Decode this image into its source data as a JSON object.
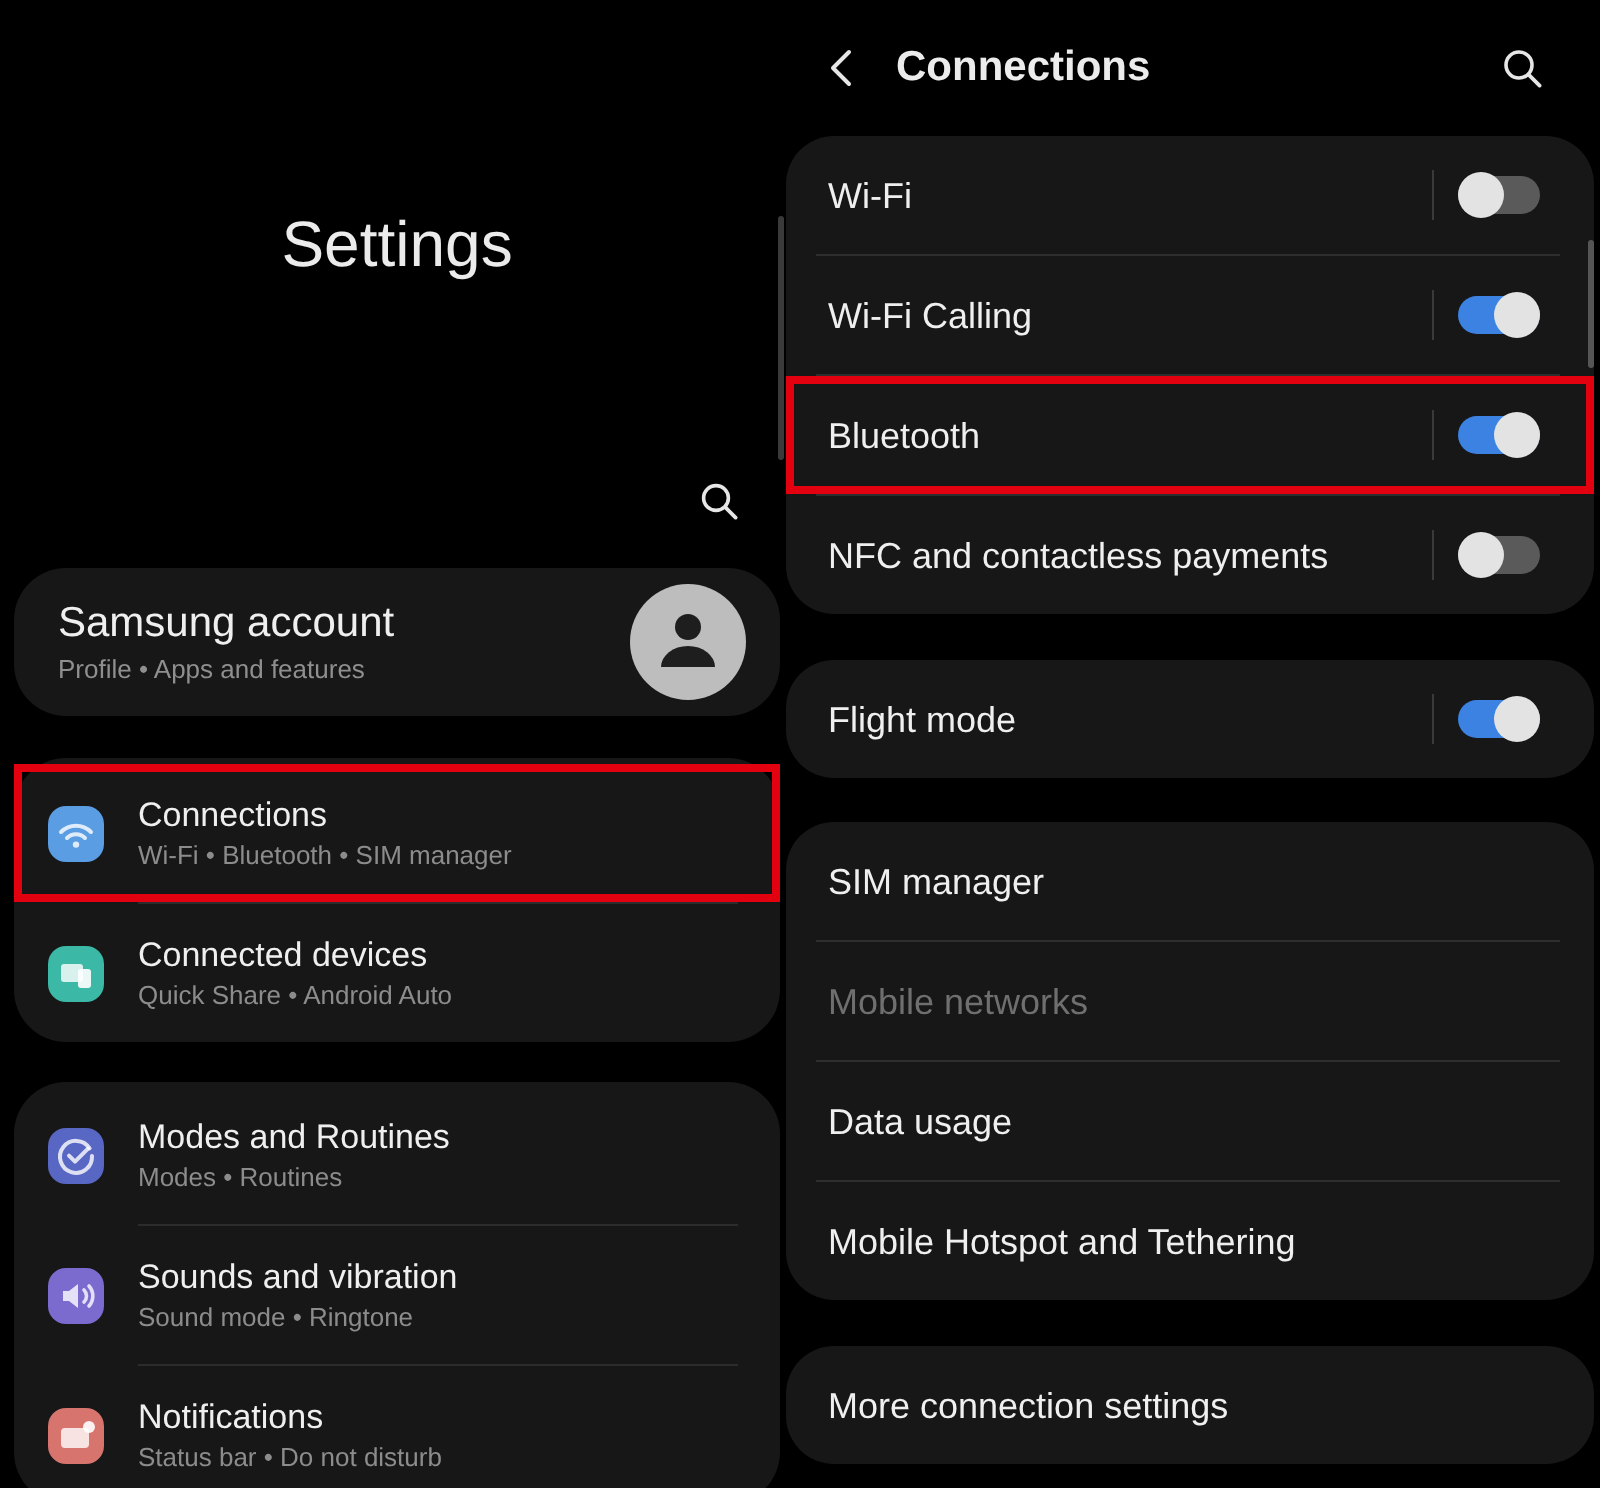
{
  "settings": {
    "title": "Settings",
    "account": {
      "title": "Samsung account",
      "subtitle": "Profile • Apps and features"
    },
    "groups": [
      {
        "items": [
          {
            "title": "Connections",
            "subtitle": "Wi-Fi • Bluetooth • SIM manager",
            "color": "#5a9de3",
            "highlighted": true
          },
          {
            "title": "Connected devices",
            "subtitle": "Quick Share • Android Auto",
            "color": "#3cb8a6",
            "highlighted": false
          }
        ]
      },
      {
        "items": [
          {
            "title": "Modes and Routines",
            "subtitle": "Modes • Routines",
            "color": "#5867c4",
            "highlighted": false
          },
          {
            "title": "Sounds and vibration",
            "subtitle": "Sound mode • Ringtone",
            "color": "#7b6bcf",
            "highlighted": false
          },
          {
            "title": "Notifications",
            "subtitle": "Status bar • Do not disturb",
            "color": "#d8746e",
            "highlighted": false
          }
        ]
      }
    ]
  },
  "connections": {
    "title": "Connections",
    "groups": [
      {
        "items": [
          {
            "label": "Wi-Fi",
            "kind": "toggle",
            "on": false,
            "highlighted": false,
            "disabled": false
          },
          {
            "label": "Wi-Fi Calling",
            "kind": "toggle",
            "on": true,
            "highlighted": false,
            "disabled": false
          },
          {
            "label": "Bluetooth",
            "kind": "toggle",
            "on": true,
            "highlighted": true,
            "disabled": false
          },
          {
            "label": "NFC and contactless payments",
            "kind": "toggle",
            "on": false,
            "highlighted": false,
            "disabled": false
          }
        ]
      },
      {
        "items": [
          {
            "label": "Flight mode",
            "kind": "toggle",
            "on": true,
            "highlighted": false,
            "disabled": false
          }
        ]
      },
      {
        "items": [
          {
            "label": "SIM manager",
            "kind": "link",
            "highlighted": false,
            "disabled": false
          },
          {
            "label": "Mobile networks",
            "kind": "link",
            "highlighted": false,
            "disabled": true
          },
          {
            "label": "Data usage",
            "kind": "link",
            "highlighted": false,
            "disabled": false
          },
          {
            "label": "Mobile Hotspot and Tethering",
            "kind": "link",
            "highlighted": false,
            "disabled": false
          }
        ]
      },
      {
        "items": [
          {
            "label": "More connection settings",
            "kind": "link",
            "highlighted": false,
            "disabled": false
          }
        ]
      }
    ]
  }
}
